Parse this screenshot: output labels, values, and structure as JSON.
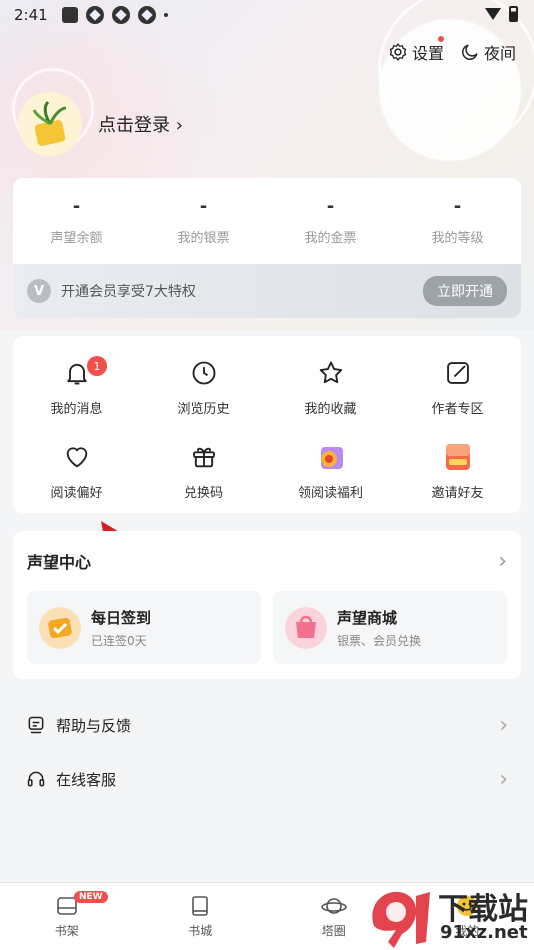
{
  "status_bar": {
    "time": "2:41"
  },
  "top_actions": {
    "settings_label": "设置",
    "night_label": "夜间"
  },
  "profile": {
    "login_label": "点击登录"
  },
  "stats": [
    {
      "value": "-",
      "label": "声望余额"
    },
    {
      "value": "-",
      "label": "我的银票"
    },
    {
      "value": "-",
      "label": "我的金票"
    },
    {
      "value": "-",
      "label": "我的等级"
    }
  ],
  "vip": {
    "text": "开通会员享受7大特权",
    "button": "立即开通"
  },
  "grid": {
    "row1": [
      {
        "label": "我的消息",
        "icon": "bell-icon",
        "badge": "1"
      },
      {
        "label": "浏览历史",
        "icon": "clock-icon"
      },
      {
        "label": "我的收藏",
        "icon": "star-icon"
      },
      {
        "label": "作者专区",
        "icon": "edit-icon"
      }
    ],
    "row2": [
      {
        "label": "阅读偏好",
        "icon": "heart-icon"
      },
      {
        "label": "兑换码",
        "icon": "gift-icon"
      },
      {
        "label": "领阅读福利",
        "icon": "reward-icon"
      },
      {
        "label": "邀请好友",
        "icon": "invite-icon"
      }
    ]
  },
  "reputation": {
    "title": "声望中心",
    "checkin": {
      "title": "每日签到",
      "sub": "已连签0天"
    },
    "shop": {
      "title": "声望商城",
      "sub": "银票、会员兑换"
    }
  },
  "menu": [
    {
      "label": "帮助与反馈",
      "icon": "feedback-icon"
    },
    {
      "label": "在线客服",
      "icon": "headset-icon"
    }
  ],
  "tabs": [
    {
      "label": "书架",
      "badge": "NEW"
    },
    {
      "label": "书城"
    },
    {
      "label": "塔圈"
    },
    {
      "label": "我的"
    }
  ],
  "watermark": {
    "line1": "下载站",
    "line2": "91xz.net"
  },
  "colors": {
    "accent_red": "#f0504a",
    "page_bg": "#f4f5f7"
  }
}
